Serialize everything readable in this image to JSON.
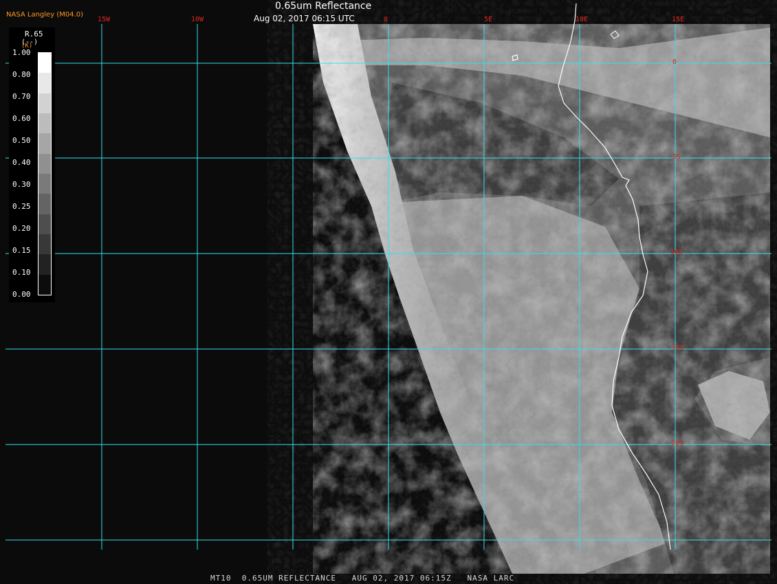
{
  "header": {
    "title": "0.65um Reflectance",
    "timestamp": "Aug 02, 2017 06:15 UTC",
    "org": "NASA Langley (M04.0)"
  },
  "footer": {
    "text": "MT10  0.65UM REFLECTANCE   AUG 02, 2017 06:15Z   NASA LARC"
  },
  "map": {
    "lon_labels": [
      "15W",
      "10W",
      "0",
      "5E",
      "10E",
      "15E"
    ],
    "lat_labels": [
      "0",
      "5S",
      "10S",
      "15S",
      "20S"
    ],
    "grid_color": "#33e0ee",
    "label_color": "#e0261e",
    "coast_color": "#ffffff"
  },
  "legend": {
    "title": "R.65",
    "unit": "(--)",
    "unit2": "(K)",
    "ticks": [
      "1.00",
      "0.80",
      "0.70",
      "0.60",
      "0.50",
      "0.40",
      "0.30",
      "0.25",
      "0.20",
      "0.15",
      "0.10",
      "0.00"
    ],
    "colors": [
      "#ffffff",
      "#e8e8e8",
      "#d2d2d2",
      "#bcbcbc",
      "#a6a6a6",
      "#909090",
      "#7a7a7a",
      "#646464",
      "#4e4e4e",
      "#383838",
      "#222222",
      "#0c0c0c"
    ]
  }
}
